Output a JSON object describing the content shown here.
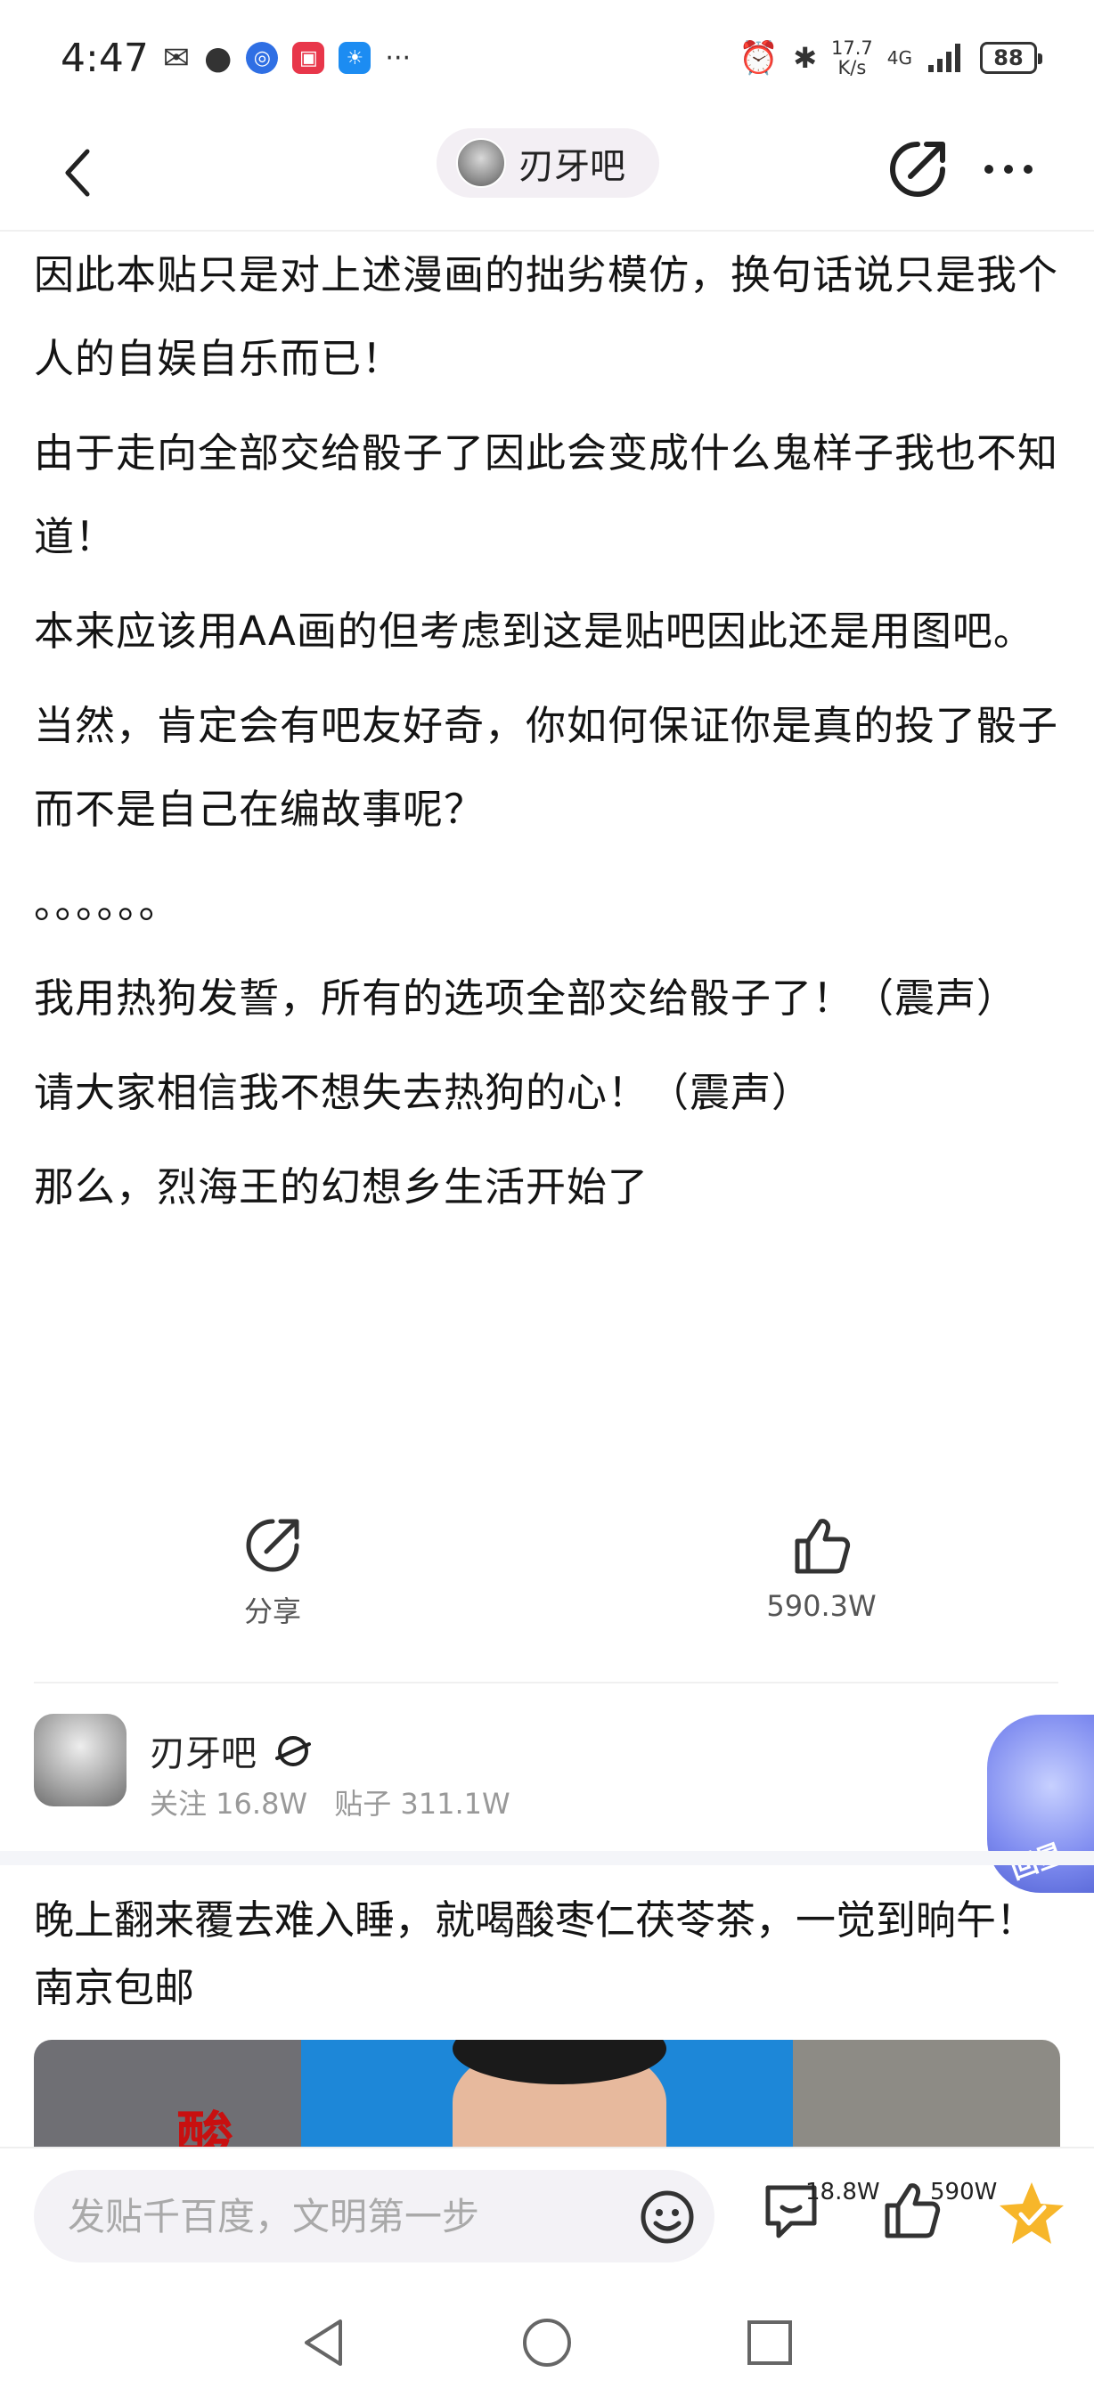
{
  "status_bar": {
    "time": "4:47",
    "more": "···",
    "net_speed_value": "17.7",
    "net_speed_unit": "K/s",
    "network": "4G",
    "battery": "88"
  },
  "top_bar": {
    "forum_name": "刃牙吧"
  },
  "post": {
    "paragraphs": [
      "因此本贴只是对上述漫画的拙劣模仿，换句话说只是我个人的自娱自乐而已！",
      "由于走向全部交给骰子了因此会变成什么鬼样子我也不知道！",
      "本来应该用AA画的但考虑到这是贴吧因此还是用图吧。",
      "当然，肯定会有吧友好奇，你如何保证你是真的投了骰子而不是自己在编故事呢？",
      "。。。。。。",
      "我用热狗发誓，所有的选项全部交给骰子了！（震声）",
      "请大家相信我不想失去热狗的心！（震声）",
      "那么，烈海王的幻想乡生活开始了"
    ]
  },
  "actions": {
    "share_label": "分享",
    "like_count": "590.3W"
  },
  "forum_card": {
    "name": "刃牙吧",
    "followers": "关注 16.8W",
    "posts": "贴子 311.1W",
    "mascot_label": "回星"
  },
  "ad": {
    "text": "晚上翻来覆去难入睡，就喝酸枣仁茯苓茶，一觉到晌午！南京包邮",
    "image_char": "酸"
  },
  "bottom_bar": {
    "input_placeholder": "发贴千百度，文明第一步",
    "comment_count": "18.8W",
    "like_count": "590W"
  },
  "colors": {
    "accent_star": "#f7b62a",
    "text": "#141414",
    "muted": "#999999"
  }
}
